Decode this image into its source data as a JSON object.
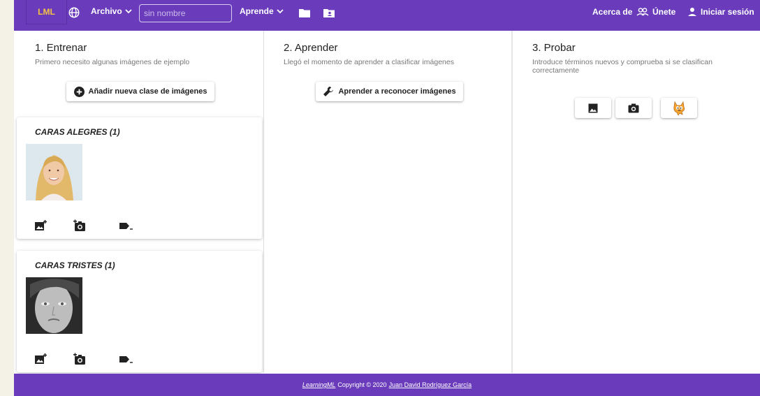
{
  "topbar": {
    "brand": "LML",
    "archivo_label": "Archivo",
    "name_placeholder": "sin nombre",
    "aprende_label": "Aprende",
    "about_label": "Acerca de",
    "join_label": "Únete",
    "login_label": "Iniciar sesión"
  },
  "col1": {
    "title": "1. Entrenar",
    "subtitle": "Primero necesito algunas imágenes de ejemplo",
    "add_class_label": "Añadir nueva clase de imágenes",
    "classes": [
      {
        "name": "CARAS ALEGRES (1)"
      },
      {
        "name": "CARAS TRISTES (1)"
      }
    ]
  },
  "col2": {
    "title": "2. Aprender",
    "subtitle": "Llegó el momento de aprender a clasificar imágenes",
    "learn_label": "Aprender a reconocer imágenes"
  },
  "col3": {
    "title": "3. Probar",
    "subtitle": "Introduce términos nuevos y comprueba si se clasifican correctamente"
  },
  "footer": {
    "app_link": "LearningML",
    "copyright": "Copyright © 2020",
    "author_link": "Juan David Rodríguez García"
  },
  "colors": {
    "primary": "#6a3cbc",
    "brand_accent": "#f5c242"
  }
}
